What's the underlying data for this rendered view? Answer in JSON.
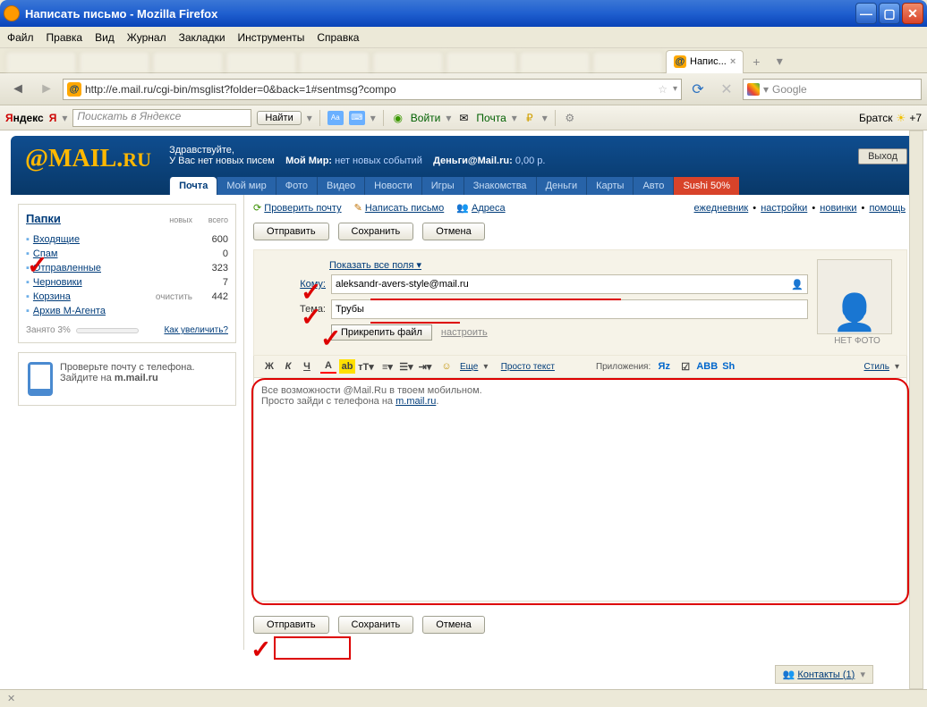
{
  "window": {
    "title": "Написать письмо - Mozilla Firefox"
  },
  "menubar": [
    "Файл",
    "Правка",
    "Вид",
    "Журнал",
    "Закладки",
    "Инструменты",
    "Справка"
  ],
  "tabs": {
    "active_label": "Напис...",
    "favicon_text": "@"
  },
  "navbar": {
    "url": "http://e.mail.ru/cgi-bin/msglist?folder=0&back=1#sentmsg?compo",
    "search_placeholder": "Google"
  },
  "yandex": {
    "logo": "Яндекс",
    "search_placeholder": "Поискать в Яндексе",
    "find": "Найти",
    "login": "Войти",
    "mail": "Почта",
    "weather_city": "Братск",
    "weather_temp": "+7"
  },
  "mailru": {
    "logo_at": "@",
    "logo_mail": "MAIL",
    "logo_ru": "RU",
    "greeting": "Здравствуйте,",
    "no_new": "У Вас нет новых писем",
    "my_world": "Мой Мир:",
    "my_world_link": "нет новых событий",
    "money": "Деньги@Mail.ru:",
    "money_val": "0,00 р.",
    "exit": "Выход",
    "tabs": [
      "Почта",
      "Мой мир",
      "Фото",
      "Видео",
      "Новости",
      "Игры",
      "Знакомства",
      "Деньги",
      "Карты",
      "Авто"
    ],
    "promo_tab": "Sushi 50%"
  },
  "sidebar": {
    "folders_title": "Папки",
    "cols": [
      "новых",
      "всего"
    ],
    "folders": [
      {
        "name": "Входящие",
        "count": "600"
      },
      {
        "name": "Спам",
        "count": "0"
      },
      {
        "name": "Отправленные",
        "count": "323"
      },
      {
        "name": "Черновики",
        "count": "7"
      },
      {
        "name": "Корзина",
        "clear": "очистить",
        "count": "442"
      },
      {
        "name": "Архив М-Агента",
        "count": ""
      }
    ],
    "quota": "Занято 3%",
    "quota_link": "Как увеличить?",
    "promo_text1": "Проверьте почту с телефона.",
    "promo_text2": "Зайдите на ",
    "promo_link": "m.mail.ru"
  },
  "actions": {
    "check": "Проверить почту",
    "write": "Написать письмо",
    "addresses": "Адреса",
    "diary": "ежедневник",
    "settings": "настройки",
    "new": "новинки",
    "help": "помощь"
  },
  "buttons": {
    "send": "Отправить",
    "save": "Сохранить",
    "cancel": "Отмена"
  },
  "compose": {
    "show_all": "Показать все поля",
    "to_label": "Кому:",
    "to_value": "aleksandr-avers-style@mail.ru",
    "subject_label": "Тема:",
    "subject_value": "Трубы",
    "attach": "Прикрепить файл",
    "attach_settings": "настроить",
    "no_photo": "НЕТ ФОТО"
  },
  "toolbar": {
    "more": "Еще",
    "plain": "Просто текст",
    "apps": "Приложения:",
    "style": "Стиль"
  },
  "editor": {
    "line1": "Все возможности @Mail.Ru в твоем мобильном.",
    "line2": "Просто зайди с телефона на ",
    "line2_link": "m.mail.ru",
    "line2_end": "."
  },
  "contacts": {
    "label": "Контакты (",
    "count": "1",
    "close": ")"
  }
}
